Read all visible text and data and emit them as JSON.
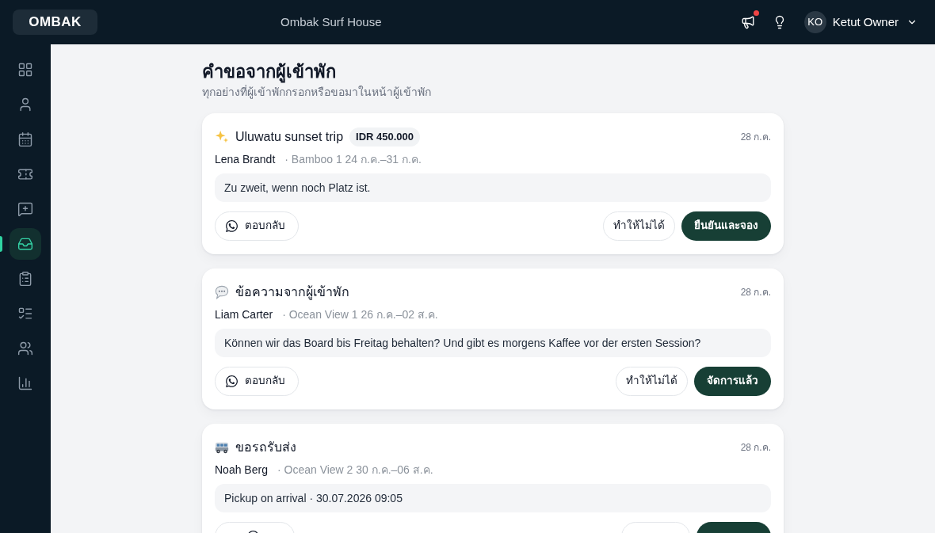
{
  "topbar": {
    "logo": "OMBAK",
    "property": "Ombak Surf House",
    "notifications": {
      "unread": true
    },
    "user": {
      "initials": "KO",
      "name": "Ketut Owner"
    }
  },
  "sidebar": {
    "items": [
      {
        "kind": "dashboard",
        "selected": false
      },
      {
        "kind": "guest",
        "selected": false
      },
      {
        "kind": "calendar",
        "selected": false
      },
      {
        "kind": "ticket",
        "selected": false
      },
      {
        "kind": "feedback",
        "selected": false
      },
      {
        "kind": "inbox",
        "selected": true
      },
      {
        "kind": "tasks",
        "selected": false
      },
      {
        "kind": "checklist",
        "selected": false
      },
      {
        "kind": "team",
        "selected": false
      },
      {
        "kind": "reports",
        "selected": false
      }
    ]
  },
  "page": {
    "title": "คำขอจากผู้เข้าพัก",
    "subtitle": "ทุกอย่างที่ผู้เข้าพักกรอกหรือขอมาในหน้าผู้เข้าพัก"
  },
  "requests": [
    {
      "kind": "addon",
      "title": "Uluwatu sunset trip",
      "price": "IDR 450.000",
      "date": "28 ก.ค.",
      "guest": "Lena Brandt",
      "stay": "· Bamboo 1 24 ก.ค.–31 ก.ค.",
      "message": "Zu zweit, wenn noch Platz ist.",
      "actions": [
        {
          "kind": "reply",
          "label": "ตอบกลับ"
        },
        {
          "kind": "decline",
          "label": "ทำให้ไม่ได้"
        },
        {
          "kind": "confirm",
          "label": "ยืนยันและจอง"
        }
      ]
    },
    {
      "kind": "message",
      "title": "ข้อความจากผู้เข้าพัก",
      "date": "28 ก.ค.",
      "guest": "Liam Carter",
      "stay": "· Ocean View 1 26 ก.ค.–02 ส.ค.",
      "message": "Können wir das Board bis Freitag behalten? Und gibt es morgens Kaffee vor der ersten Session?",
      "actions": [
        {
          "kind": "reply",
          "label": "ตอบกลับ"
        },
        {
          "kind": "decline",
          "label": "ทำให้ไม่ได้"
        },
        {
          "kind": "confirm",
          "label": "จัดการแล้ว"
        }
      ]
    },
    {
      "kind": "transfer",
      "title": "ขอรถรับส่ง",
      "date": "28 ก.ค.",
      "guest": "Noah Berg",
      "stay": "· Ocean View 2 30 ก.ค.–06 ส.ค.",
      "message": "Pickup on arrival · 30.07.2026 09:05",
      "actions": [
        {
          "kind": "reply"
        },
        {
          "kind": "decline"
        },
        {
          "kind": "confirm"
        }
      ]
    }
  ]
}
